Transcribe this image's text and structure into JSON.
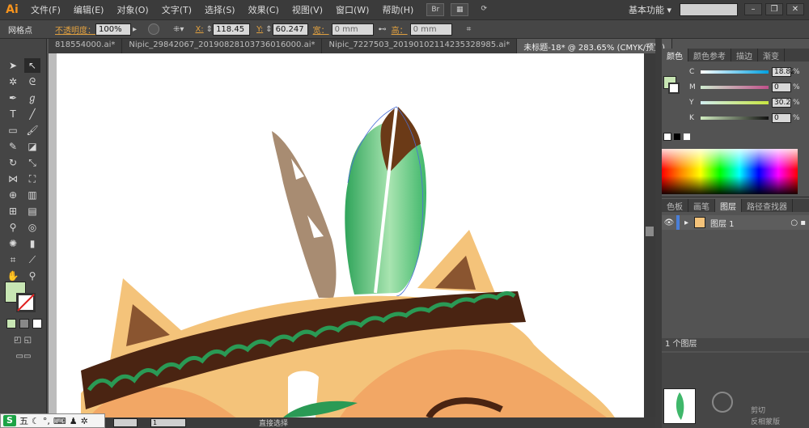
{
  "app": {
    "logo": "Ai"
  },
  "menu": [
    "文件(F)",
    "编辑(E)",
    "对象(O)",
    "文字(T)",
    "选择(S)",
    "效果(C)",
    "视图(V)",
    "窗口(W)",
    "帮助(H)"
  ],
  "header": {
    "workspace": "基本功能",
    "win_minimize": "–",
    "win_maximize": "❐",
    "win_close": "✕"
  },
  "controlbar": {
    "mode_label": "网格点",
    "opacity_label": "不透明度：",
    "opacity_value": "100%",
    "x_label": "X:",
    "x_value": "118.45",
    "y_label": "Y:",
    "y_value": "60.247",
    "w_label": "宽：",
    "w_value": "0 mm",
    "h_label": "高：",
    "h_value": "0 mm"
  },
  "tabs": [
    {
      "label": "818554000.ai*",
      "active": false
    },
    {
      "label": "Nipic_29842067_20190828103736016000.ai*",
      "active": false
    },
    {
      "label": "Nipic_7227503_20190102114235328985.ai*",
      "active": false
    },
    {
      "label": "未标题-18* @ 283.65% (CMYK/预览)",
      "active": true
    }
  ],
  "color_panel": {
    "tabs": [
      "颜色",
      "颜色参考",
      "描边",
      "渐变"
    ],
    "cmyk": [
      {
        "label": "C",
        "value": "18.82",
        "unit": "%"
      },
      {
        "label": "M",
        "value": "0",
        "unit": "%"
      },
      {
        "label": "Y",
        "value": "30.2",
        "unit": "%"
      },
      {
        "label": "K",
        "value": "0",
        "unit": "%"
      }
    ]
  },
  "layers_panel": {
    "tabs": [
      "色板",
      "画笔",
      "图层",
      "路径查找器"
    ],
    "layer_name": "图层 1",
    "footer": "1 个图层"
  },
  "bottom_panel": {
    "clip_label": "剪切",
    "invert_label": "反相蒙版"
  },
  "status": {
    "zoom_field": "",
    "page_field": "1",
    "tool_name": "直接选择"
  },
  "ime": {
    "logo": "S",
    "mode": "五"
  },
  "colors": {
    "fill": "#c8e6b4",
    "feather_brown": "#a88c72",
    "feather_green": "#3fb76a",
    "feather_tip": "#6b3a17",
    "headband": "#4a2412",
    "zigzag": "#2a9a55",
    "fox_orange": "#f4c37a",
    "fox_face": "#f2a765",
    "ear_inner": "#8a5530"
  }
}
